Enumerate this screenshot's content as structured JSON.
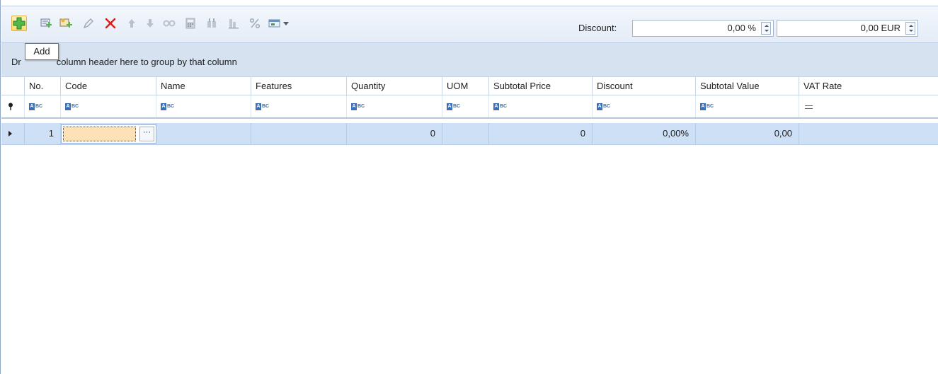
{
  "toolbar": {
    "buttons": [
      {
        "name": "add-icon",
        "tooltip": "Add"
      },
      {
        "name": "add-from-list-icon"
      },
      {
        "name": "add-new-item-icon"
      },
      {
        "name": "edit-icon"
      },
      {
        "name": "delete-icon"
      },
      {
        "name": "move-up-icon"
      },
      {
        "name": "move-down-icon"
      },
      {
        "name": "split-icon"
      },
      {
        "name": "calculator-icon"
      },
      {
        "name": "find-icon"
      },
      {
        "name": "inventory-icon"
      },
      {
        "name": "percent-icon"
      },
      {
        "name": "view-options-icon"
      }
    ],
    "tooltip": "Add",
    "discount_label": "Discount:",
    "discount_percent": "0,00 %",
    "discount_amount": "0,00 EUR"
  },
  "group_panel": {
    "text_left": "Dr",
    "text": "column header here to group by that column"
  },
  "grid": {
    "columns": [
      "No.",
      "Code",
      "Name",
      "Features",
      "Quantity",
      "UOM",
      "Subtotal Price",
      "Discount",
      "Subtotal Value",
      "VAT Rate"
    ],
    "rows": [
      {
        "no": "1",
        "code": "",
        "name": "",
        "features": "",
        "quantity": "0",
        "uom": "",
        "subtotal_price": "0",
        "discount": "0,00%",
        "subtotal_value": "0,00",
        "vat_rate": ""
      }
    ],
    "code_button": "···"
  },
  "colors": {
    "toolbar_bg": "#e4ecf7",
    "group_panel_bg": "#d6e2f0",
    "selected_row": "#cde0f6",
    "active_cell": "#fde2b8",
    "add_icon": "#3ca334",
    "delete_icon": "#e02020"
  }
}
